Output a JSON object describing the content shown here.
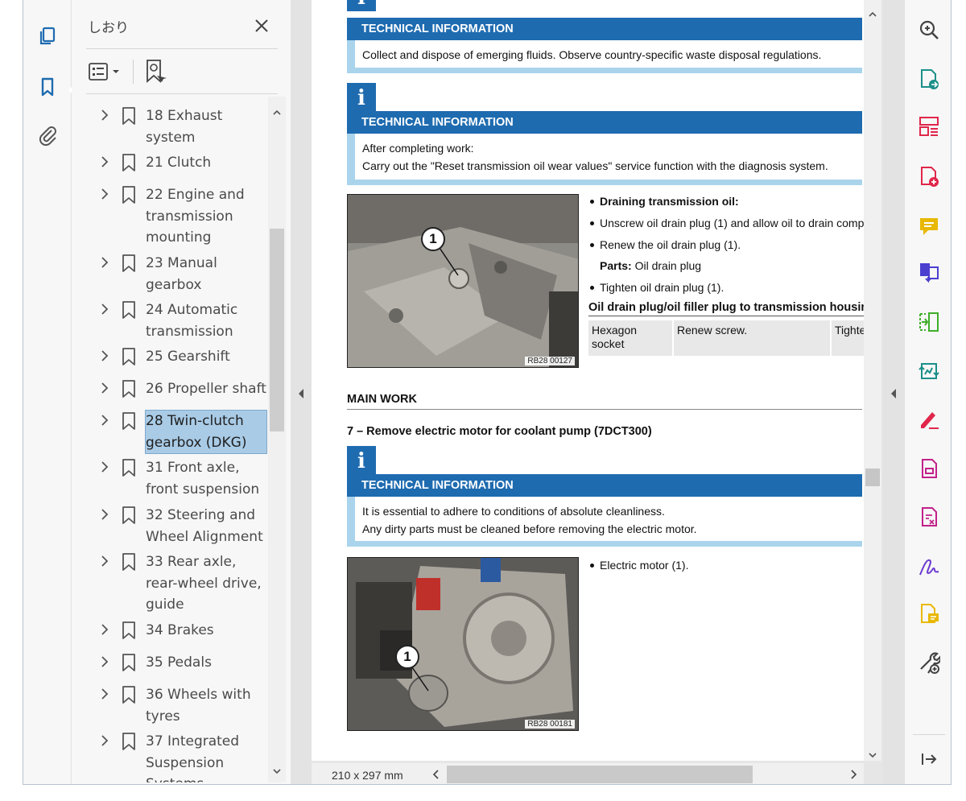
{
  "left_rail": {
    "icons": [
      "pages-icon",
      "bookmark-icon",
      "attachment-icon"
    ]
  },
  "bookmarks_panel": {
    "title": "しおり",
    "items": [
      {
        "label": "18 Exhaust system",
        "selected": false
      },
      {
        "label": "21 Clutch",
        "selected": false
      },
      {
        "label": "22 Engine and transmission mounting",
        "selected": false
      },
      {
        "label": "23 Manual gearbox",
        "selected": false
      },
      {
        "label": "24 Automatic transmission",
        "selected": false
      },
      {
        "label": "25 Gearshift",
        "selected": false
      },
      {
        "label": "26 Propeller shaft",
        "selected": false
      },
      {
        "label": "28 Twin-clutch gearbox (DKG)",
        "selected": true
      },
      {
        "label": "31 Front axle, front suspension",
        "selected": false
      },
      {
        "label": "32 Steering and Wheel Alignment",
        "selected": false
      },
      {
        "label": "33 Rear axle, rear-wheel drive, guide",
        "selected": false
      },
      {
        "label": "34 Brakes",
        "selected": false
      },
      {
        "label": "35 Pedals",
        "selected": false
      },
      {
        "label": "36 Wheels with tyres",
        "selected": false
      },
      {
        "label": "37 Integrated Suspension Systems",
        "selected": false
      }
    ]
  },
  "document": {
    "ti1": {
      "header": "TECHNICAL INFORMATION",
      "lines": [
        "Collect and dispose of emerging fluids. Observe country-specific waste disposal regulations."
      ]
    },
    "ti2": {
      "header": "TECHNICAL INFORMATION",
      "lines": [
        "After completing work:",
        "Carry out the \"Reset transmission oil wear values\" service function with the diagnosis system."
      ]
    },
    "photo1": {
      "code": "RB28 00127",
      "callout": "1"
    },
    "steps1": {
      "draining": "Draining transmission oil:",
      "unscrew": "Unscrew oil drain plug (1) and allow oil to drain comp",
      "renew": "Renew the oil drain plug (1).",
      "parts_label": "Parts:",
      "parts_value": "Oil drain plug",
      "tighten": "Tighten oil drain plug (1)."
    },
    "spec": {
      "title": "Oil drain plug/oil filler plug to transmission housin",
      "col1": "Hexagon socket",
      "col2": "Renew screw.",
      "col3": "Tighte"
    },
    "main_work": "MAIN WORK",
    "step7_title": "7 – Remove electric motor for coolant pump (7DCT300)",
    "ti3": {
      "header": "TECHNICAL INFORMATION",
      "lines": [
        "It is essential to adhere to conditions of absolute cleanliness.",
        "Any dirty parts must be cleaned before removing the electric motor."
      ]
    },
    "photo2": {
      "code": "RB28 00181",
      "callout": "1"
    },
    "steps2": {
      "electric_motor": "Electric motor (1)."
    },
    "page_size": "210 x 297 mm"
  },
  "colors": {
    "ti_blue": "#1e6bb0",
    "ti_light": "#a9d4ec",
    "selection": "#a9cbe6"
  },
  "right_tools": [
    "zoom-icon",
    "export-pdf-icon",
    "organize-pages-icon",
    "create-pdf-icon",
    "comment-icon",
    "combine-files-icon",
    "compress-icon",
    "compare-icon",
    "fill-sign-icon",
    "pdf-form-icon",
    "redact-icon",
    "signature-icon",
    "send-for-comments-icon",
    "more-tools-icon",
    "collapse-panel-icon"
  ]
}
